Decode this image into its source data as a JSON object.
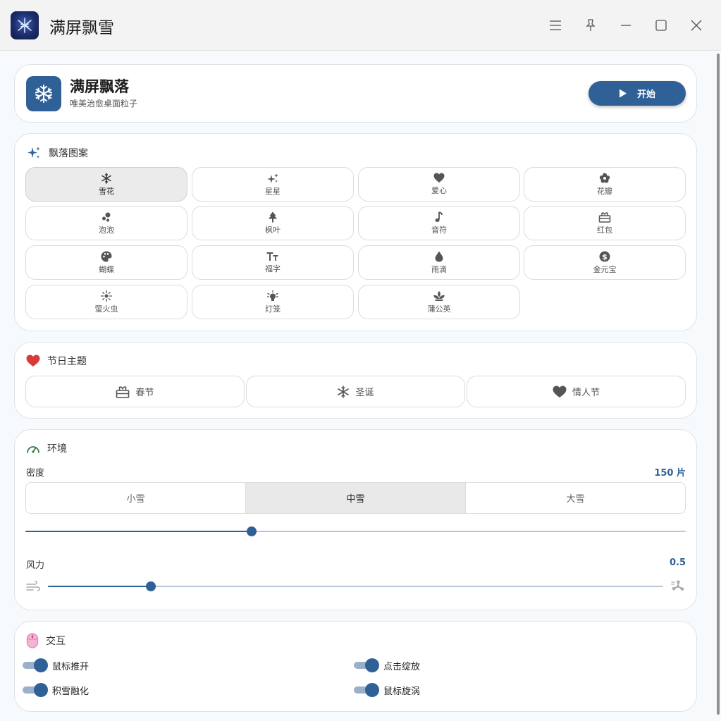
{
  "window": {
    "title": "满屏飘雪",
    "controls": [
      "menu-icon",
      "pin-icon",
      "minimize-icon",
      "maximize-icon",
      "close-icon"
    ]
  },
  "hero": {
    "title": "满屏飘落",
    "subtitle": "唯美治愈桌面粒子",
    "start_label": "开始"
  },
  "patterns": {
    "heading": "飘落图案",
    "selected": "雪花",
    "items": [
      {
        "label": "雪花",
        "icon": "snowflake-icon"
      },
      {
        "label": "星星",
        "icon": "sparkles-icon"
      },
      {
        "label": "爱心",
        "icon": "heart-icon"
      },
      {
        "label": "花瓣",
        "icon": "flower-icon"
      },
      {
        "label": "泡泡",
        "icon": "bubbles-icon"
      },
      {
        "label": "枫叶",
        "icon": "tree-icon"
      },
      {
        "label": "音符",
        "icon": "music-note-icon"
      },
      {
        "label": "红包",
        "icon": "gift-icon"
      },
      {
        "label": "蝴蝶",
        "icon": "palette-icon"
      },
      {
        "label": "福字",
        "icon": "text-size-icon"
      },
      {
        "label": "雨滴",
        "icon": "drop-icon"
      },
      {
        "label": "金元宝",
        "icon": "dollar-coin-icon"
      },
      {
        "label": "萤火虫",
        "icon": "firefly-icon"
      },
      {
        "label": "灯笼",
        "icon": "lantern-icon"
      },
      {
        "label": "蒲公英",
        "icon": "lotus-icon"
      }
    ]
  },
  "themes": {
    "heading": "节日主题",
    "items": [
      {
        "label": "春节",
        "icon": "gift-icon"
      },
      {
        "label": "圣诞",
        "icon": "snowflake-icon"
      },
      {
        "label": "情人节",
        "icon": "heart-icon"
      }
    ]
  },
  "environment": {
    "heading": "环境",
    "density_label": "密度",
    "density_value": "150 片",
    "density_fraction": 0.343,
    "presets": [
      "小雪",
      "中雪",
      "大雪"
    ],
    "selected_preset": "中雪",
    "wind_label": "风力",
    "wind_value": "0.5",
    "wind_fraction": 0.167
  },
  "interaction": {
    "heading": "交互",
    "toggles": [
      {
        "label": "鼠标推开",
        "on": true
      },
      {
        "label": "点击绽放",
        "on": true
      },
      {
        "label": "积雪融化",
        "on": true
      },
      {
        "label": "鼠标旋涡",
        "on": true
      }
    ]
  },
  "colors": {
    "accent": "#2f6196",
    "heart": "#d93a3a",
    "gauge": "#3d7a4a",
    "mouse": "#e58bb6"
  }
}
